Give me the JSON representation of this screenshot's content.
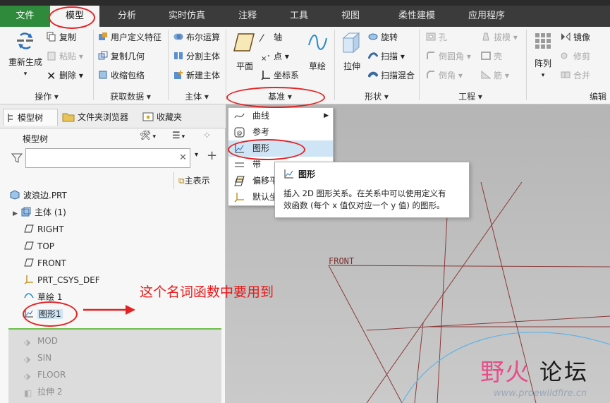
{
  "tabs": [
    "文件",
    "模型",
    "分析",
    "实时仿真",
    "注释",
    "工具",
    "视图",
    "柔性建模",
    "应用程序"
  ],
  "ribbon": {
    "ops": {
      "regen": "重新生成",
      "copy": "复制",
      "paste": "粘贴",
      "delete": "删除",
      "label": "操作"
    },
    "getdata": {
      "udf": "用户定义特征",
      "copygeom": "复制几何",
      "shrinkwrap": "收缩包络",
      "label": "获取数据"
    },
    "body": {
      "boolean": "布尔运算",
      "split": "分割主体",
      "newbody": "新建主体",
      "label": "主体"
    },
    "datum": {
      "plane": "平面",
      "axis": "轴",
      "point": "点",
      "csys": "坐标系",
      "sketch": "草绘",
      "label": "基准"
    },
    "shape": {
      "extrude": "拉伸",
      "revolve": "旋转",
      "sweep": "扫描",
      "sweepblend": "扫描混合",
      "label": "形状"
    },
    "eng": {
      "hole": "孔",
      "round": "倒圆角",
      "chamfer": "倒角",
      "draft": "拔模",
      "shell": "壳",
      "rib": "筋",
      "label": "工程"
    },
    "edit": {
      "pattern": "阵列",
      "mirror": "镜像",
      "trim": "修剪",
      "merge": "合并",
      "label": "编辑"
    }
  },
  "panel": {
    "tabs": [
      "模型树",
      "文件夹浏览器",
      "收藏夹"
    ],
    "tree_header": "模型树",
    "search_placeholder": "",
    "master_rep": "主表示"
  },
  "tree": [
    {
      "label": "波浪边.PRT",
      "icon": "part-icon"
    },
    {
      "label": "主体 (1)",
      "icon": "body-icon"
    },
    {
      "label": "RIGHT",
      "icon": "plane-icon"
    },
    {
      "label": "TOP",
      "icon": "plane-icon"
    },
    {
      "label": "FRONT",
      "icon": "plane-icon"
    },
    {
      "label": "PRT_CSYS_DEF",
      "icon": "csys-icon"
    },
    {
      "label": "草绘 1",
      "icon": "sketch-icon"
    },
    {
      "label": "图形1",
      "icon": "graph-icon"
    }
  ],
  "tree_suppressed": [
    {
      "label": "MOD"
    },
    {
      "label": "SIN"
    },
    {
      "label": "FLOOR"
    },
    {
      "label": "拉伸 2"
    }
  ],
  "dropdown": [
    "曲线",
    "参考",
    "图形",
    "带",
    "偏移平面",
    "默认坐标系"
  ],
  "tooltip": {
    "title": "图形",
    "line1": "插入 2D 图形关系。在关系中可以使用定义有",
    "line2": "效函数 (每个 x 值仅对应一个 y 值) 的图形。"
  },
  "viewport": {
    "front_label": "FRONT"
  },
  "annotation": "这个名词函数中要用到",
  "watermark": {
    "part1": "野火",
    "part2": "论坛",
    "url": "www.proewildfire.cn"
  },
  "colors": {
    "accent_red": "#e32323",
    "file_tab": "#2f8a3c",
    "highlight": "#cfe4f5"
  }
}
